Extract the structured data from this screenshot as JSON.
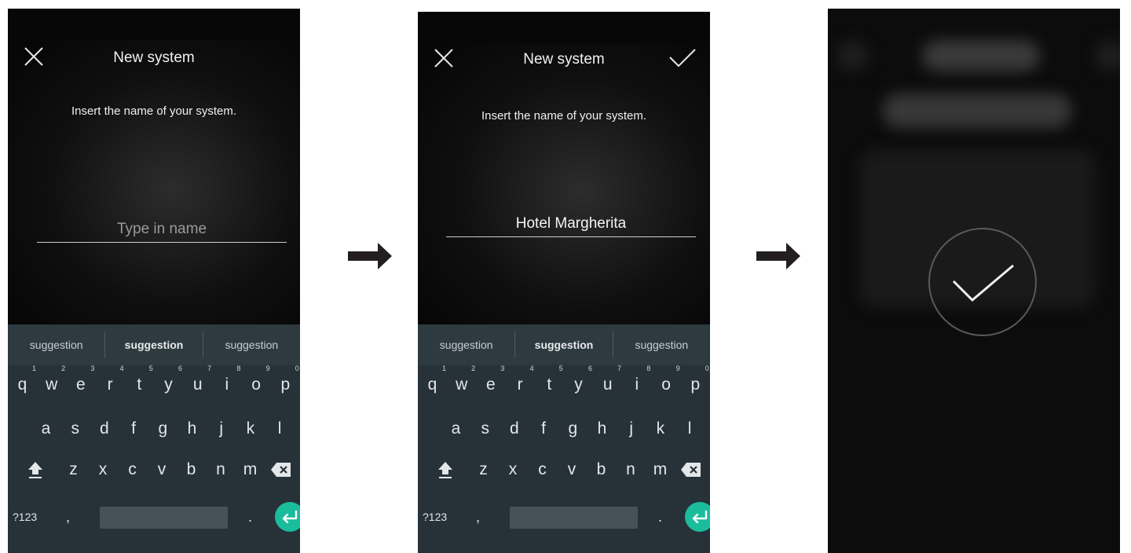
{
  "screens": [
    {
      "title": "New system",
      "subtitle": "Insert the name of your system.",
      "field": {
        "placeholder": "Type in name",
        "value": ""
      },
      "has_confirm": false
    },
    {
      "title": "New system",
      "subtitle": "Insert the name of your system.",
      "field": {
        "placeholder": "",
        "value": "Hotel Margherita"
      },
      "has_confirm": true
    },
    {
      "state": "success",
      "icons": [
        "check-icon"
      ]
    }
  ],
  "keyboard": {
    "suggestions": [
      "suggestion",
      "suggestion",
      "suggestion"
    ],
    "row1": [
      {
        "k": "q",
        "n": "1"
      },
      {
        "k": "w",
        "n": "2"
      },
      {
        "k": "e",
        "n": "3"
      },
      {
        "k": "r",
        "n": "4"
      },
      {
        "k": "t",
        "n": "5"
      },
      {
        "k": "y",
        "n": "6"
      },
      {
        "k": "u",
        "n": "7"
      },
      {
        "k": "i",
        "n": "8"
      },
      {
        "k": "o",
        "n": "9"
      },
      {
        "k": "p",
        "n": "0"
      }
    ],
    "row2": [
      "a",
      "s",
      "d",
      "f",
      "g",
      "h",
      "j",
      "k",
      "l"
    ],
    "row3": [
      "z",
      "x",
      "c",
      "v",
      "b",
      "n",
      "m"
    ],
    "symbols_label": "?123",
    "comma": ",",
    "period": "."
  },
  "icons": {
    "close": "close-icon",
    "confirm": "check-icon",
    "shift": "shift-icon",
    "backspace": "backspace-icon",
    "enter": "enter-icon",
    "arrow": "arrow-right-icon"
  },
  "colors": {
    "screen_bg": "#070707",
    "keyboard_bg": "#263238",
    "enter_accent": "#1abc9c"
  }
}
